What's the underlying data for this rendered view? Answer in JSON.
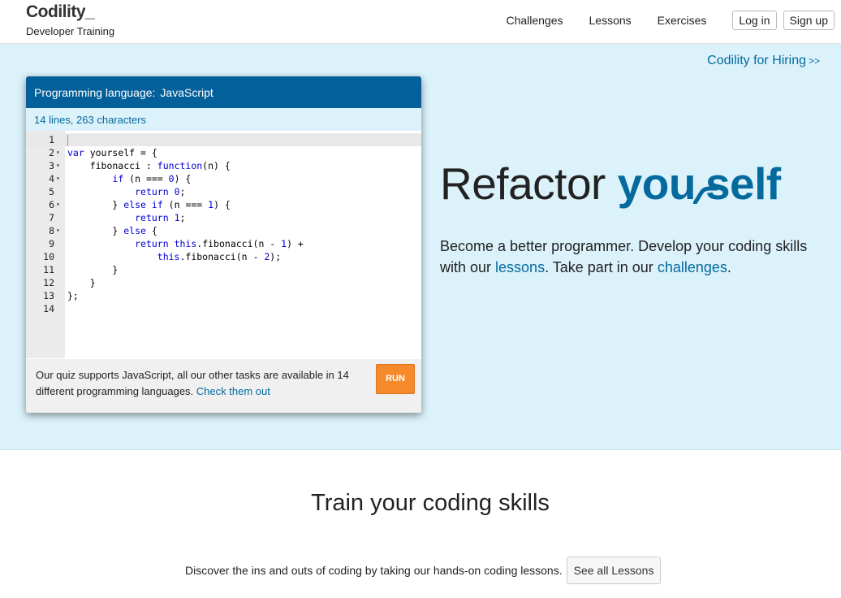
{
  "header": {
    "brand_logo": "Codility_",
    "brand_subtitle": "Developer Training",
    "nav": [
      "Challenges",
      "Lessons",
      "Exercises"
    ],
    "login_label": "Log in",
    "signup_label": "Sign up"
  },
  "hero": {
    "hiring_link": "Codility for Hiring",
    "hiring_arrow": ">>",
    "title_plain": "Refactor ",
    "title_accent": "you",
    "title_accent_end": "self",
    "desc_part1": "Become a better programmer. Develop your coding skills with our ",
    "desc_link1": "lessons",
    "desc_part2": ". Take part in our ",
    "desc_link2": "challenges",
    "desc_part3": "."
  },
  "editor": {
    "lang_label": "Programming language:",
    "lang_value": "JavaScript",
    "stats": "14 lines, 263 characters",
    "footer_text": "Our quiz supports JavaScript, all our other tasks are available in 14 different programming languages.",
    "footer_link": "Check them out",
    "run_label": "RUN",
    "lines": [
      {
        "n": "1",
        "fold": "",
        "code": ""
      },
      {
        "n": "2",
        "fold": "▾",
        "code": "var yourself = {"
      },
      {
        "n": "3",
        "fold": "▾",
        "code": "    fibonacci : function(n) {"
      },
      {
        "n": "4",
        "fold": "▾",
        "code": "        if (n === 0) {"
      },
      {
        "n": "5",
        "fold": "",
        "code": "            return 0;"
      },
      {
        "n": "6",
        "fold": "▾",
        "code": "        } else if (n === 1) {"
      },
      {
        "n": "7",
        "fold": "",
        "code": "            return 1;"
      },
      {
        "n": "8",
        "fold": "▾",
        "code": "        } else {"
      },
      {
        "n": "9",
        "fold": "",
        "code": "            return this.fibonacci(n - 1) +"
      },
      {
        "n": "10",
        "fold": "",
        "code": "                this.fibonacci(n - 2);"
      },
      {
        "n": "11",
        "fold": "",
        "code": "        }"
      },
      {
        "n": "12",
        "fold": "",
        "code": "    }"
      },
      {
        "n": "13",
        "fold": "",
        "code": "};"
      },
      {
        "n": "14",
        "fold": "",
        "code": ""
      }
    ]
  },
  "training": {
    "title": "Train your coding skills",
    "lessons_text": "Discover the ins and outs of coding by taking our hands-on coding lessons.",
    "lessons_button": "See all Lessons"
  },
  "colors": {
    "accent": "#046a9e",
    "editor_header": "#04609a",
    "hero_bg": "#dcf2fb",
    "run_button": "#f68a2b"
  }
}
